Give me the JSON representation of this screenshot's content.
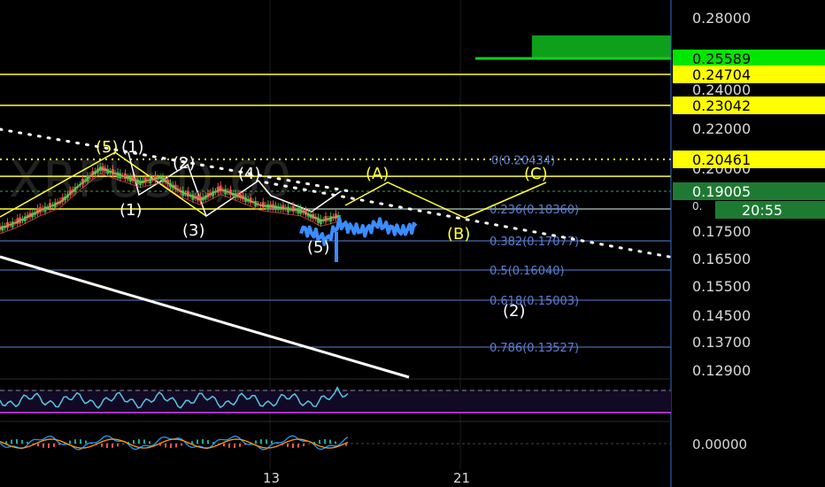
{
  "symbol_watermark": "XRPUSD,60",
  "price_axis": {
    "ticks": [
      {
        "label": "0.28000",
        "value": 0.28
      },
      {
        "label": "0.24000",
        "value": 0.24
      },
      {
        "label": "0.22000",
        "value": 0.22
      },
      {
        "label": "0.20000",
        "value": 0.2
      },
      {
        "label": "0.17500",
        "value": 0.175
      },
      {
        "label": "0.16500",
        "value": 0.165
      },
      {
        "label": "0.15500",
        "value": 0.155
      },
      {
        "label": "0.14500",
        "value": 0.145
      },
      {
        "label": "0.13700",
        "value": 0.137
      },
      {
        "label": "0.12900",
        "value": 0.129
      }
    ],
    "badges": [
      {
        "label": "0.25589",
        "value": 0.25589,
        "bg": "#00e600",
        "fg": "#000000"
      },
      {
        "label": "0.24704",
        "value": 0.24704,
        "bg": "#ffff00",
        "fg": "#000000"
      },
      {
        "label": "0.23042",
        "value": 0.23042,
        "bg": "#ffff00",
        "fg": "#000000"
      },
      {
        "label": "0.20461",
        "value": 0.20461,
        "bg": "#ffff00",
        "fg": "#000000"
      },
      {
        "label": "0.19005",
        "value": 0.19005,
        "bg": "#1e7a32",
        "fg": "#ffffff"
      }
    ],
    "countdown": "20:55"
  },
  "oscillator_axis": {
    "label": "0.00000"
  },
  "time_axis": {
    "labels": [
      {
        "label": "13",
        "pos": "13"
      },
      {
        "label": "21",
        "pos": "21"
      }
    ]
  },
  "wave_labels": [
    {
      "label": "(5)",
      "color": "#ffff66"
    },
    {
      "label": "(1)",
      "color": "#ffffff"
    },
    {
      "label": "(2)",
      "color": "#ffffff"
    },
    {
      "label": "(4)",
      "color": "#ffffff"
    },
    {
      "label": "(1)",
      "color": "#ffffff"
    },
    {
      "label": "(3)",
      "color": "#ffffff"
    },
    {
      "label": "(5)",
      "color": "#ffffff"
    },
    {
      "label": "(A)",
      "color": "#ffff33"
    },
    {
      "label": "(C)",
      "color": "#ffff33"
    },
    {
      "label": "(B)",
      "color": "#ffff33"
    },
    {
      "label": "(2)",
      "color": "#ffffff"
    }
  ],
  "fib_levels": [
    {
      "label": "0.236(0.18360)",
      "value": 0.1836
    },
    {
      "label": "0.382(0.17077)",
      "value": 0.17077
    },
    {
      "label": "0.5(0.16040)",
      "value": 0.1604
    },
    {
      "label": "0.618(0.15003)",
      "value": 0.15003
    },
    {
      "label": "0.786(0.13527)",
      "value": 0.13527
    }
  ],
  "fib_top": {
    "label": "0(0.20434)",
    "value": 0.20434
  },
  "colors": {
    "background": "#000000",
    "horizontal_level": "#ffff33",
    "fib_line": "#5b7fd6",
    "price_line": "#3fa34d",
    "candle_up": "#4caf50",
    "candle_down": "#ef5350",
    "projection": "#3b8cff",
    "trendline": "#ffffff",
    "rsi": "#54c6e8",
    "osc_band": "#e040fb"
  },
  "chart_data": {
    "type": "line",
    "title": "",
    "xlabel": "",
    "ylabel": "",
    "ylim": [
      0.125,
      0.285
    ],
    "horizontal_levels": [
      0.25589,
      0.24704,
      0.23042,
      0.20461,
      0.19005,
      0.1836
    ],
    "series": [
      {
        "values": [
          0.176,
          0.179,
          0.183,
          0.186,
          0.193,
          0.2,
          0.197,
          0.194,
          0.196,
          0.19,
          0.187,
          0.191,
          0.188,
          0.185,
          0.184,
          0.183,
          0.179,
          0.181
        ]
      },
      {
        "values": [
          0.176,
          0.174,
          0.171,
          0.178,
          0.176,
          0.175,
          0.178,
          0.176,
          0.175,
          0.177
        ]
      }
    ]
  }
}
